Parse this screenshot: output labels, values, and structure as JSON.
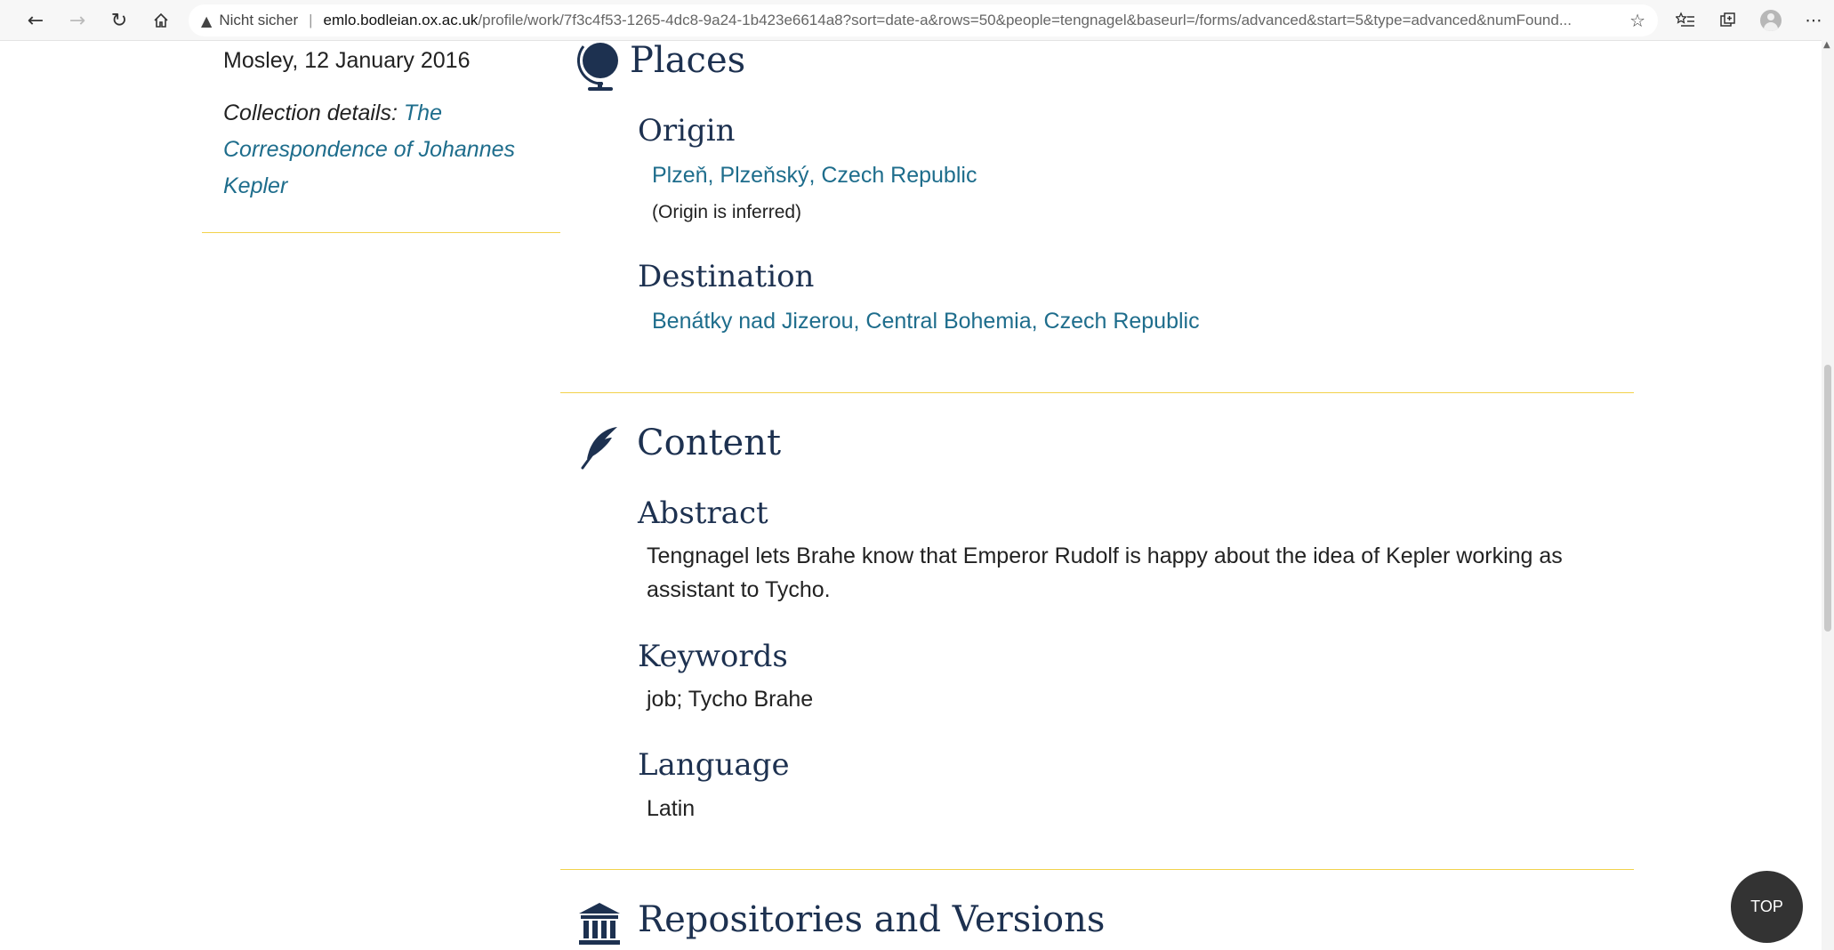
{
  "browser": {
    "security_label": "Nicht sicher",
    "url_host": "emlo.bodleian.ox.ac.uk",
    "url_rest": "/profile/work/7f3c4f53-1265-4dc8-9a24-1b423e6614a8?sort=date-a&rows=50&people=tengnagel&baseurl=/forms/advanced&start=5&type=advanced&numFound..."
  },
  "sidebar": {
    "date_line": "Mosley, 12 January 2016",
    "collection_label": "Collection details:",
    "collection_link": "The Correspondence of Johannes Kepler"
  },
  "places": {
    "title": "Places",
    "origin_heading": "Origin",
    "origin_link": "Plzeň, Plzeňský, Czech Republic",
    "origin_note": "(Origin is inferred)",
    "destination_heading": "Destination",
    "destination_link": "Benátky nad Jizerou, Central Bohemia, Czech Republic"
  },
  "content": {
    "title": "Content",
    "abstract_heading": "Abstract",
    "abstract_text": "Tengnagel lets Brahe know that Emperor Rudolf is happy about the idea of Kepler working as assistant to Tycho.",
    "keywords_heading": "Keywords",
    "keywords_text": "job; Tycho Brahe",
    "language_heading": "Language",
    "language_text": "Latin"
  },
  "repositories": {
    "title": "Repositories and Versions"
  },
  "top_button": "TOP",
  "colors": {
    "heading": "#1d3150",
    "link": "#1e6d8c",
    "rule": "#f2d24b",
    "top_button_bg": "#333333"
  }
}
